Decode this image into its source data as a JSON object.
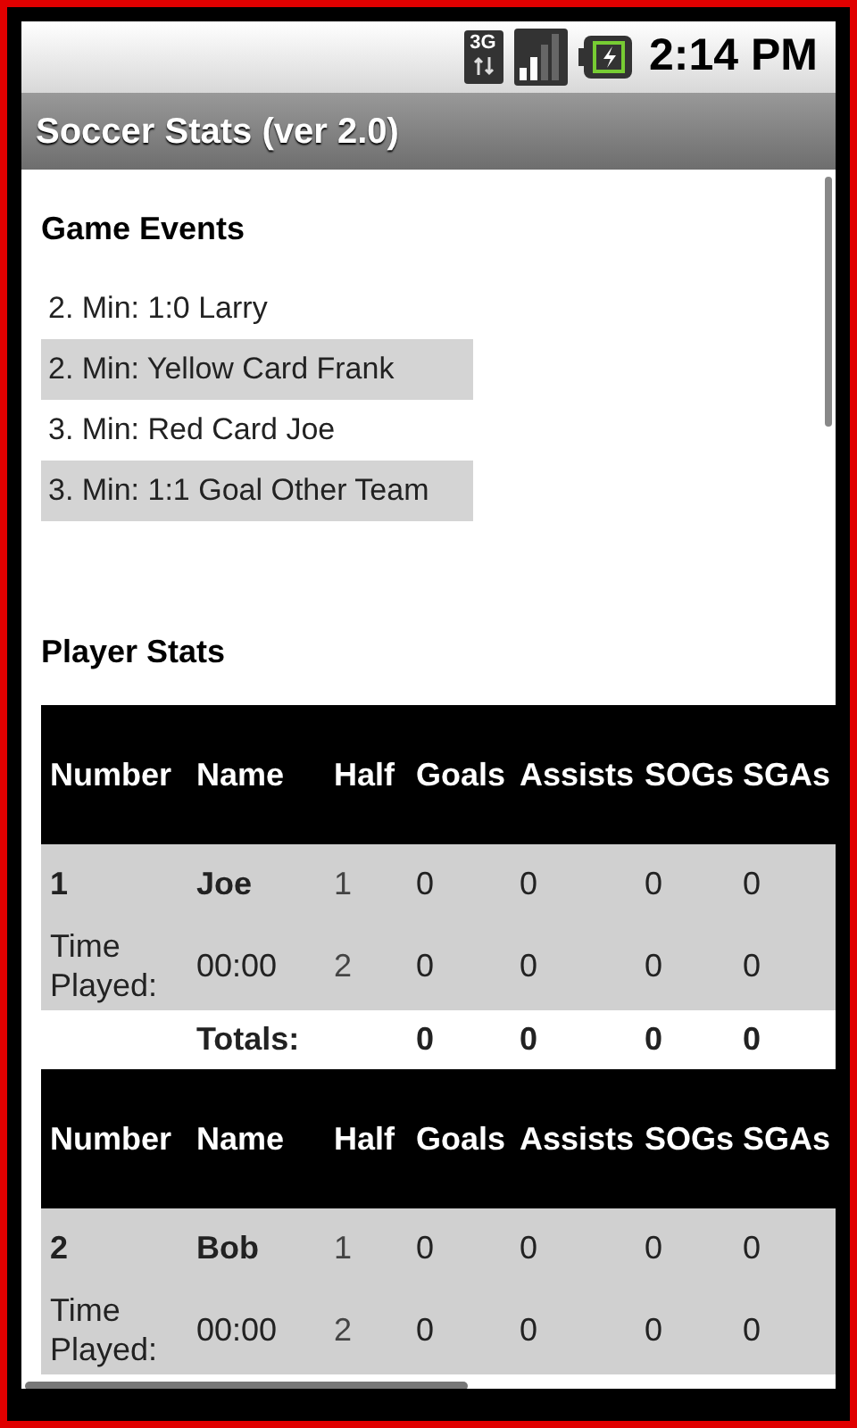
{
  "status_bar": {
    "time": "2:14 PM",
    "network": "3G"
  },
  "window": {
    "title": "Soccer Stats (ver 2.0)"
  },
  "game_events": {
    "title": "Game Events",
    "items": [
      {
        "text": "2. Min: 1:0 Larry",
        "shaded": false
      },
      {
        "text": "2. Min: Yellow Card Frank",
        "shaded": true
      },
      {
        "text": "3. Min: Red Card Joe",
        "shaded": false
      },
      {
        "text": "3. Min: 1:1 Goal Other Team",
        "shaded": true
      }
    ]
  },
  "player_stats": {
    "title": "Player Stats",
    "players": [
      {
        "columns": [
          "Number",
          "Name",
          "Half",
          "Goals",
          "Assists",
          "SOGs",
          "SGAs"
        ],
        "rows": [
          [
            "1",
            "Joe",
            "1",
            "0",
            "0",
            "0",
            "0"
          ],
          [
            "Time Played:",
            "00:00",
            "2",
            "0",
            "0",
            "0",
            "0"
          ]
        ],
        "totals": [
          "Totals:",
          "0",
          "0",
          "0",
          "0"
        ]
      },
      {
        "columns": [
          "Number",
          "Name",
          "Half",
          "Goals",
          "Assists",
          "SOGs",
          "SGAs"
        ],
        "rows": [
          [
            "2",
            "Bob",
            "1",
            "0",
            "0",
            "0",
            "0"
          ],
          [
            "Time Played:",
            "00:00",
            "2",
            "0",
            "0",
            "0",
            "0"
          ]
        ]
      }
    ]
  }
}
